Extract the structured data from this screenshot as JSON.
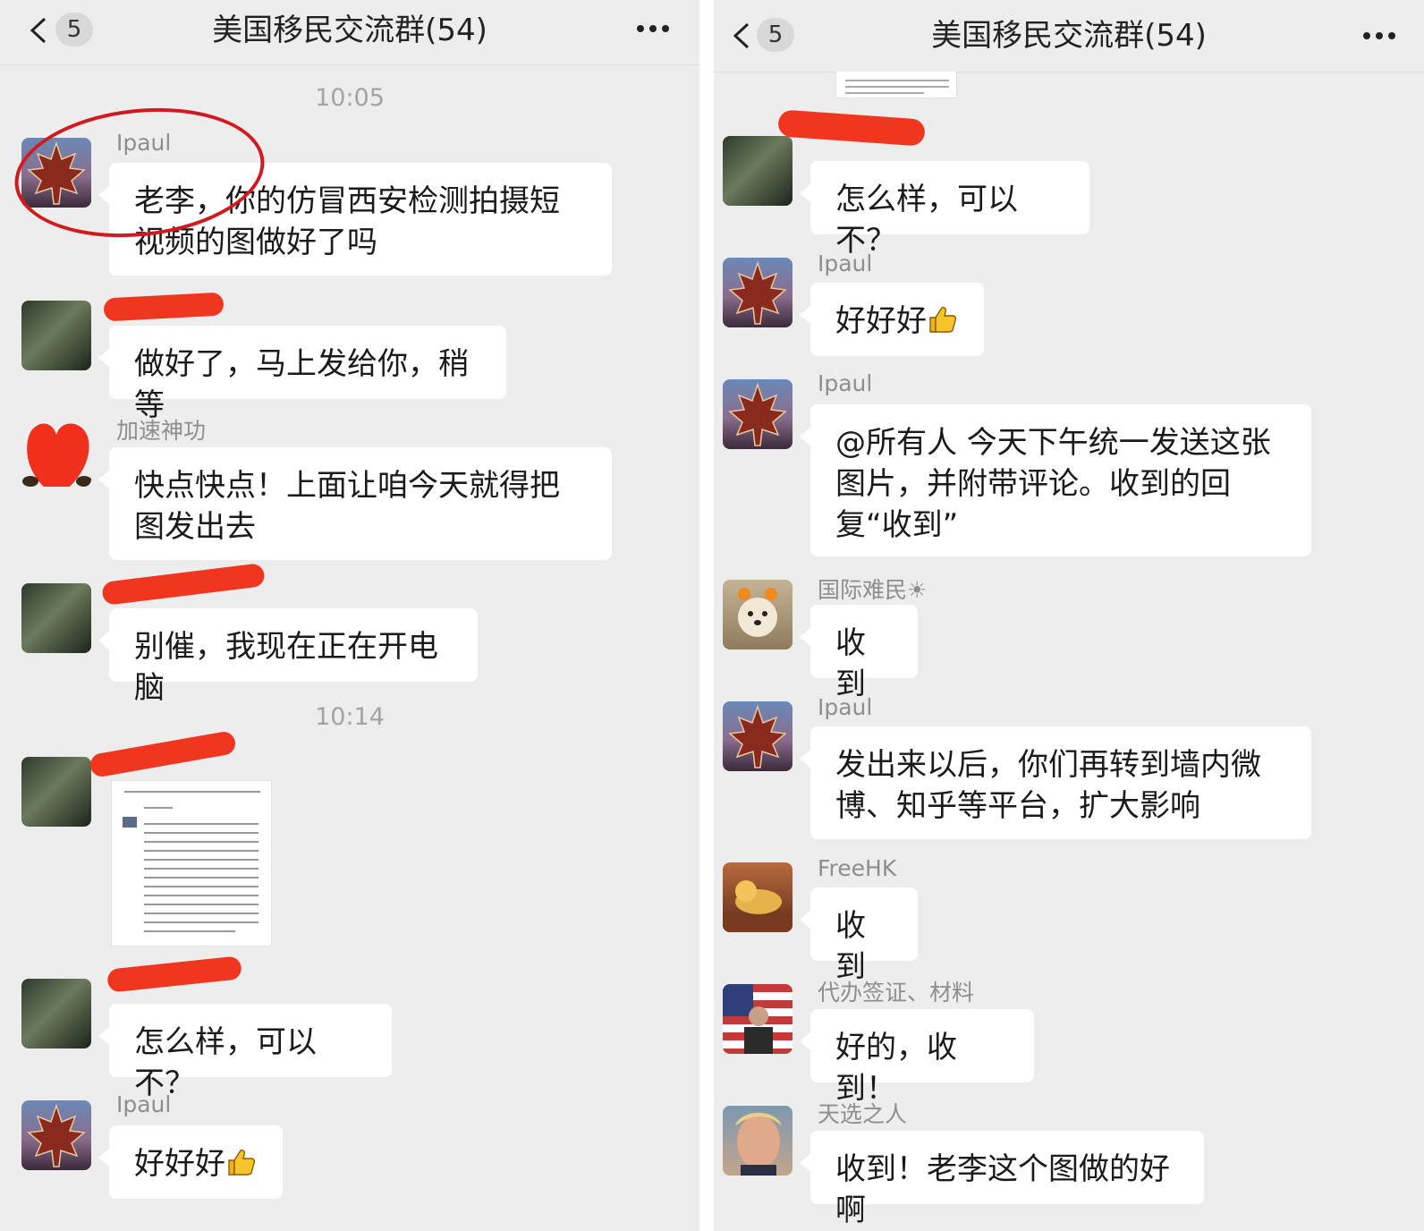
{
  "left": {
    "header": {
      "title": "美国移民交流群(54)",
      "unread": "5"
    },
    "times": [
      "10:05",
      "10:14"
    ],
    "messages": [
      {
        "sender": "Ipaul",
        "text": "老李，你的仿冒西安检测拍摄短视频的图做好了吗"
      },
      {
        "sender": "",
        "text": "做好了，马上发给你，稍等"
      },
      {
        "sender": "加速神功",
        "text": "快点快点！上面让咱今天就得把图发出去"
      },
      {
        "sender": "",
        "text": "别催，我现在正在开电脑"
      },
      {
        "sender": "",
        "text": "怎么样，可以不？"
      },
      {
        "sender": "Ipaul",
        "text": "好好好"
      }
    ]
  },
  "right": {
    "header": {
      "title": "美国移民交流群(54)",
      "unread": "5"
    },
    "messages": [
      {
        "sender": "",
        "text": "怎么样，可以不？"
      },
      {
        "sender": "Ipaul",
        "text": "好好好"
      },
      {
        "sender": "Ipaul",
        "text": "@所有人 今天下午统一发送这张图片，并附带评论。收到的回复“收到”"
      },
      {
        "sender": "国际难民☀",
        "text": "收到"
      },
      {
        "sender": "Ipaul",
        "text": "发出来以后，你们再转到墙内微博、知乎等平台，扩大影响"
      },
      {
        "sender": "FreeHK",
        "text": "收到"
      },
      {
        "sender": "代办签证、材料",
        "text": "好的，收到！"
      },
      {
        "sender": "天选之人",
        "text": "收到！老李这个图做的好啊"
      }
    ]
  },
  "icons": {
    "back": "chevron-left-icon",
    "more": "more-dots-icon",
    "thumbs": "thumbs-up-emoji"
  },
  "colors": {
    "background": "#ededed",
    "bubble": "#ffffff",
    "redaction": "#f0361f",
    "annotation_circle": "#d2191d",
    "sender_text": "#8e8e8e"
  }
}
